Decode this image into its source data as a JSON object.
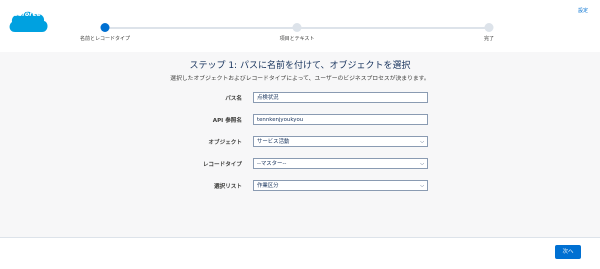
{
  "header": {
    "logo_text": "salesforce",
    "settings_label": "設定",
    "steps": [
      {
        "label": "名前とレコードタイプ"
      },
      {
        "label": "項目とテキスト"
      },
      {
        "label": "完了"
      }
    ],
    "active_step_color": "#0070d2"
  },
  "main": {
    "title": "ステップ 1: パスに名前を付けて、オブジェクトを選択",
    "subtitle": "選択したオブジェクトおよびレコードタイプによって、ユーザーのビジネスプロセスが決まります。",
    "fields": [
      {
        "label": "パス名",
        "value": "点検状況"
      },
      {
        "label": "API 参照名",
        "value": "tennkenjyoukyou"
      },
      {
        "label": "オブジェクト",
        "value": "サービス活動"
      },
      {
        "label": "レコードタイプ",
        "value": "--マスター--"
      },
      {
        "label": "選択リスト",
        "value": "作業区分"
      }
    ]
  },
  "footer": {
    "next_label": "次へ"
  },
  "icons": {
    "logo": "salesforce-cloud-logo",
    "select_caret": "chevron-down-icon"
  }
}
